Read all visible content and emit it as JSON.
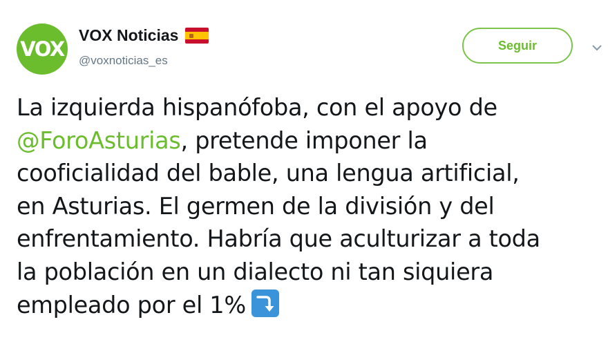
{
  "tweet": {
    "avatar_text": "VOX",
    "display_name": "VOX Noticias",
    "handle": "@voxnoticias_es",
    "follow_label": "Seguir",
    "text": {
      "line1": "La izquierda hispanófoba, con el apoyo de",
      "mention": "@ForoAsturias",
      "line2_rest": ", pretende imponer la",
      "line3": "cooficialidad del bable, una lengua artificial,",
      "line4": "en Asturias. El germen de la división y del",
      "line5": "enfrentamiento. Habría que aculturizar a toda",
      "line6": "la población en un dialecto ni tan siquiera",
      "line7": "empleado por el 1%"
    },
    "icons": {
      "flag": "spain-flag-icon",
      "caret": "chevron-down-icon",
      "emoji": "right-arrow-curving-down-icon"
    },
    "colors": {
      "brand_green": "#6bbd2e",
      "text": "#14171a",
      "secondary": "#657786",
      "emoji_blue": "#3b94d9"
    }
  }
}
